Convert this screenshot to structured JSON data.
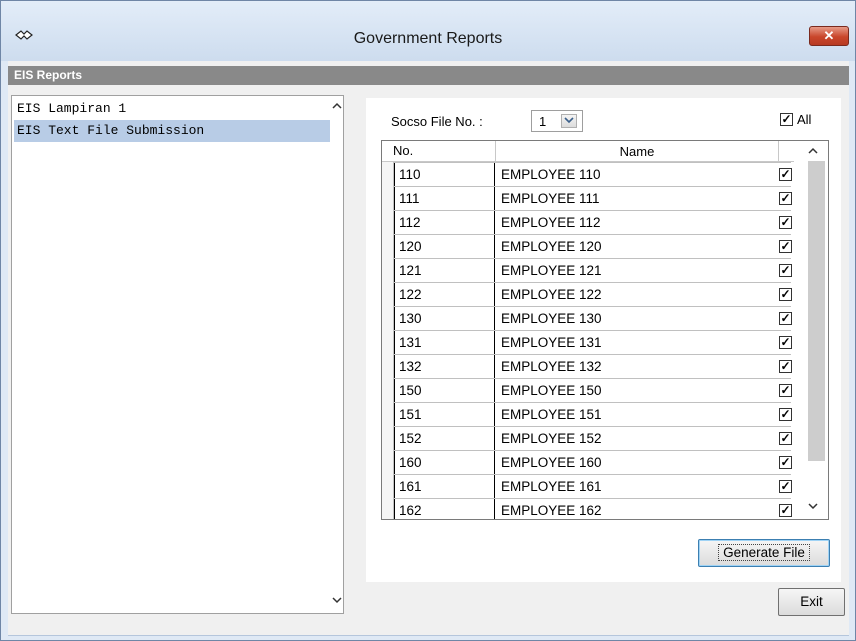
{
  "window": {
    "title": "Government Reports",
    "close_label": "✕",
    "accent_close": "#c9462b"
  },
  "section": {
    "header": "EIS Reports"
  },
  "reports": {
    "items": [
      {
        "label": "EIS Lampiran 1",
        "selected": false
      },
      {
        "label": "EIS Text File Submission",
        "selected": true
      }
    ],
    "scroll_up": "^",
    "scroll_down": "v"
  },
  "filter": {
    "socso_label": "Socso File No. :",
    "socso_value": "1",
    "all_checked": true,
    "all_label": "All",
    "check_mark": "✓"
  },
  "grid": {
    "columns": {
      "no": "No.",
      "name": "Name"
    },
    "rows": [
      {
        "no": "110",
        "name": "EMPLOYEE 110",
        "checked": true
      },
      {
        "no": "111",
        "name": "EMPLOYEE 111",
        "checked": true
      },
      {
        "no": "112",
        "name": "EMPLOYEE 112",
        "checked": true
      },
      {
        "no": "120",
        "name": "EMPLOYEE 120",
        "checked": true
      },
      {
        "no": "121",
        "name": "EMPLOYEE 121",
        "checked": true
      },
      {
        "no": "122",
        "name": "EMPLOYEE 122",
        "checked": true
      },
      {
        "no": "130",
        "name": "EMPLOYEE 130",
        "checked": true
      },
      {
        "no": "131",
        "name": "EMPLOYEE 131",
        "checked": true
      },
      {
        "no": "132",
        "name": "EMPLOYEE 132",
        "checked": true
      },
      {
        "no": "150",
        "name": "EMPLOYEE 150",
        "checked": true
      },
      {
        "no": "151",
        "name": "EMPLOYEE 151",
        "checked": true
      },
      {
        "no": "152",
        "name": "EMPLOYEE 152",
        "checked": true
      },
      {
        "no": "160",
        "name": "EMPLOYEE 160",
        "checked": true
      },
      {
        "no": "161",
        "name": "EMPLOYEE 161",
        "checked": true
      },
      {
        "no": "162",
        "name": "EMPLOYEE 162",
        "checked": true
      }
    ]
  },
  "buttons": {
    "generate": "Generate File",
    "exit": "Exit"
  },
  "icons": {
    "app": "glasses-icon",
    "close": "close-icon",
    "scroll_up": "chevron-up-icon",
    "scroll_down": "chevron-down-icon",
    "dropdown": "chevron-down-icon",
    "check": "checkmark-icon"
  }
}
